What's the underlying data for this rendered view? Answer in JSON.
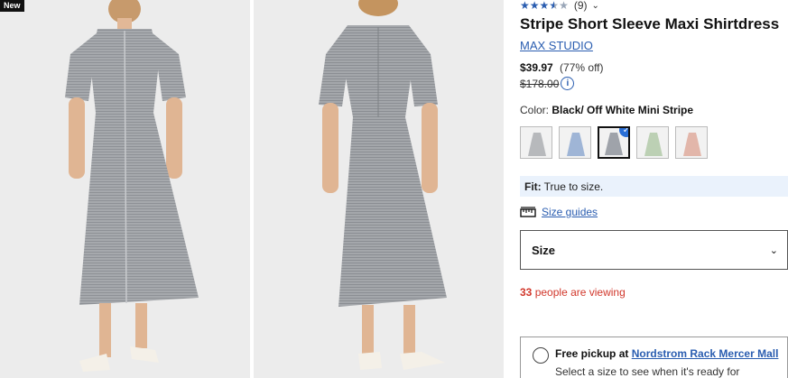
{
  "badge": "New",
  "rating": {
    "stars": [
      "★",
      "★",
      "★",
      "★",
      "★"
    ],
    "count": "(9)",
    "chevron": "⌄"
  },
  "product": {
    "title": "Stripe Short Sleeve Maxi Shirtdress",
    "brand": "MAX STUDIO",
    "price": "$39.97",
    "discount": "(77% off)",
    "original_price": "$178.00",
    "info_icon": "i"
  },
  "color": {
    "label": "Color:",
    "value": "Black/ Off White Mini Stripe",
    "swatch_check": "✓",
    "swatches": [
      {
        "name": "grey-stripe",
        "color": "#b7b9bc"
      },
      {
        "name": "blue-stripe",
        "color": "#9fb5d6"
      },
      {
        "name": "black-off-white-mini-stripe",
        "color": "#9fa3aa"
      },
      {
        "name": "sage-stripe",
        "color": "#bcd0b4"
      },
      {
        "name": "pink-stripe",
        "color": "#e2b6aa"
      }
    ]
  },
  "fit": {
    "label": "Fit:",
    "value": "True to size."
  },
  "size_guides": "Size guides",
  "size_select": {
    "label": "Size",
    "chevron": "⌄"
  },
  "viewing": {
    "count": "33",
    "text": "people are viewing"
  },
  "pickup": {
    "prefix": "Free pickup at",
    "store": "Nordstrom Rack Mercer Mall",
    "subtext": "Select a size to see when it's ready for"
  },
  "colors": {
    "accent": "#2a5db0",
    "alert": "#d1372b",
    "fit_bg": "#eaf2fc"
  }
}
